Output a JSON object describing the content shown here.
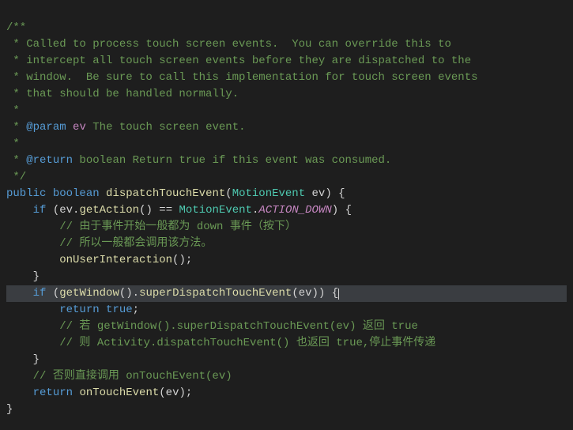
{
  "javadoc": {
    "open": "/**",
    "line1": " * Called to process touch screen events.  You can override this to",
    "line2": " * intercept all touch screen events before they are dispatched to the",
    "line3": " * window.  Be sure to call this implementation for touch screen events",
    "line4": " * that should be handled normally.",
    "blank": " *",
    "param_prefix": " * ",
    "param_tag": "@param",
    "param_name": "ev",
    "param_desc": " The touch screen event.",
    "return_tag": "@return",
    "return_desc": " boolean Return true if this event was consumed.",
    "close": " */"
  },
  "code": {
    "kw_public": "public",
    "kw_boolean": "boolean",
    "method_name": "dispatchTouchEvent",
    "param_type": "MotionEvent",
    "param_var": "ev",
    "kw_if": "if",
    "call_getAction": "getAction",
    "op_eq": "==",
    "class_MotionEvent": "MotionEvent",
    "const_ACTION_DOWN": "ACTION_DOWN",
    "comment1": "// 由于事件开始一般都为 down 事件（按下）",
    "comment2": "// 所以一般都会调用该方法。",
    "call_onUserInteraction": "onUserInteraction",
    "call_getWindow": "getWindow",
    "call_superDispatch": "superDispatchTouchEvent",
    "kw_return": "return",
    "lit_true": "true",
    "comment3": "// 若 getWindow().superDispatchTouchEvent(ev) 返回 true",
    "comment4": "// 则 Activity.dispatchTouchEvent() 也返回 true,停止事件传递",
    "comment5": "// 否则直接调用 onTouchEvent(ev)",
    "call_onTouchEvent": "onTouchEvent"
  }
}
